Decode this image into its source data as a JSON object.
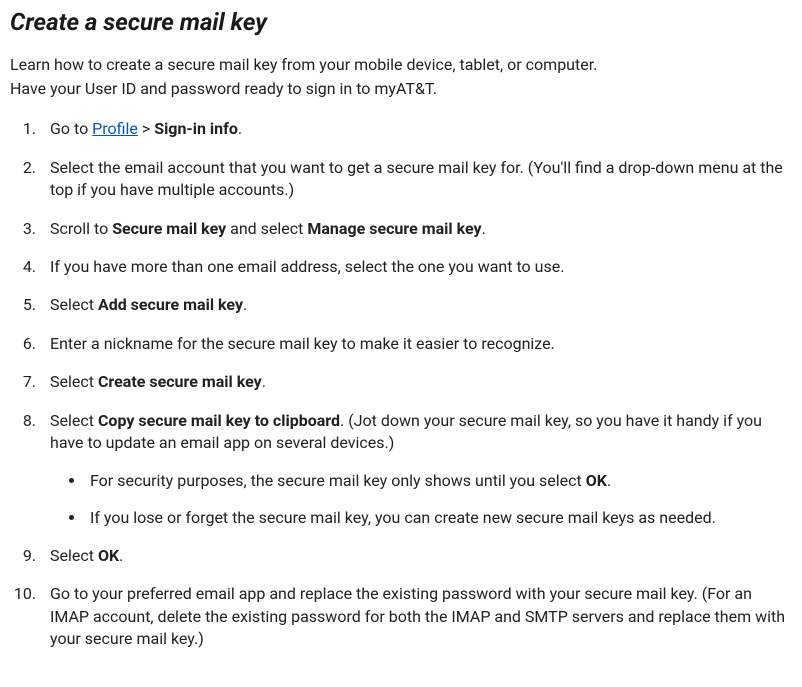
{
  "title": "Create a secure mail key",
  "intro": {
    "line1": "Learn how to create a secure mail key from your mobile device, tablet, or computer.",
    "line2": "Have your User ID and password ready to sign in to myAT&T."
  },
  "steps": {
    "s1": {
      "pre": "Go to ",
      "link": "Profile",
      "sep": " > ",
      "bold": "Sign-in info",
      "post": "."
    },
    "s2": "Select the email account that you want to get a secure mail key for. (You'll find a drop-down menu at the top if you have multiple accounts.)",
    "s3": {
      "pre": "Scroll to ",
      "bold1": "Secure mail key",
      "mid": " and select ",
      "bold2": "Manage secure mail key",
      "post": "."
    },
    "s4": "If you have more than one email address, select the one you want to use.",
    "s5": {
      "pre": "Select ",
      "bold": "Add secure mail key",
      "post": "."
    },
    "s6": "Enter a nickname for the secure mail key to make it easier to recognize.",
    "s7": {
      "pre": "Select ",
      "bold": "Create secure mail key",
      "post": "."
    },
    "s8": {
      "pre": "Select ",
      "bold": "Copy secure mail key to clipboard",
      "post": ". (Jot down your secure mail key, so you have it handy if you have to update an email app on several devices.)",
      "sub1": {
        "pre": "For security purposes, the secure mail key only shows until you select ",
        "bold": "OK",
        "post": "."
      },
      "sub2": "If you lose or forget the secure mail key, you can create new secure mail keys as needed."
    },
    "s9": {
      "pre": "Select ",
      "bold": "OK",
      "post": "."
    },
    "s10": "Go to your preferred email app and replace the existing password with your secure mail key. (For an IMAP account, delete the existing password for both the IMAP and SMTP servers and replace them with your secure mail key.)"
  }
}
